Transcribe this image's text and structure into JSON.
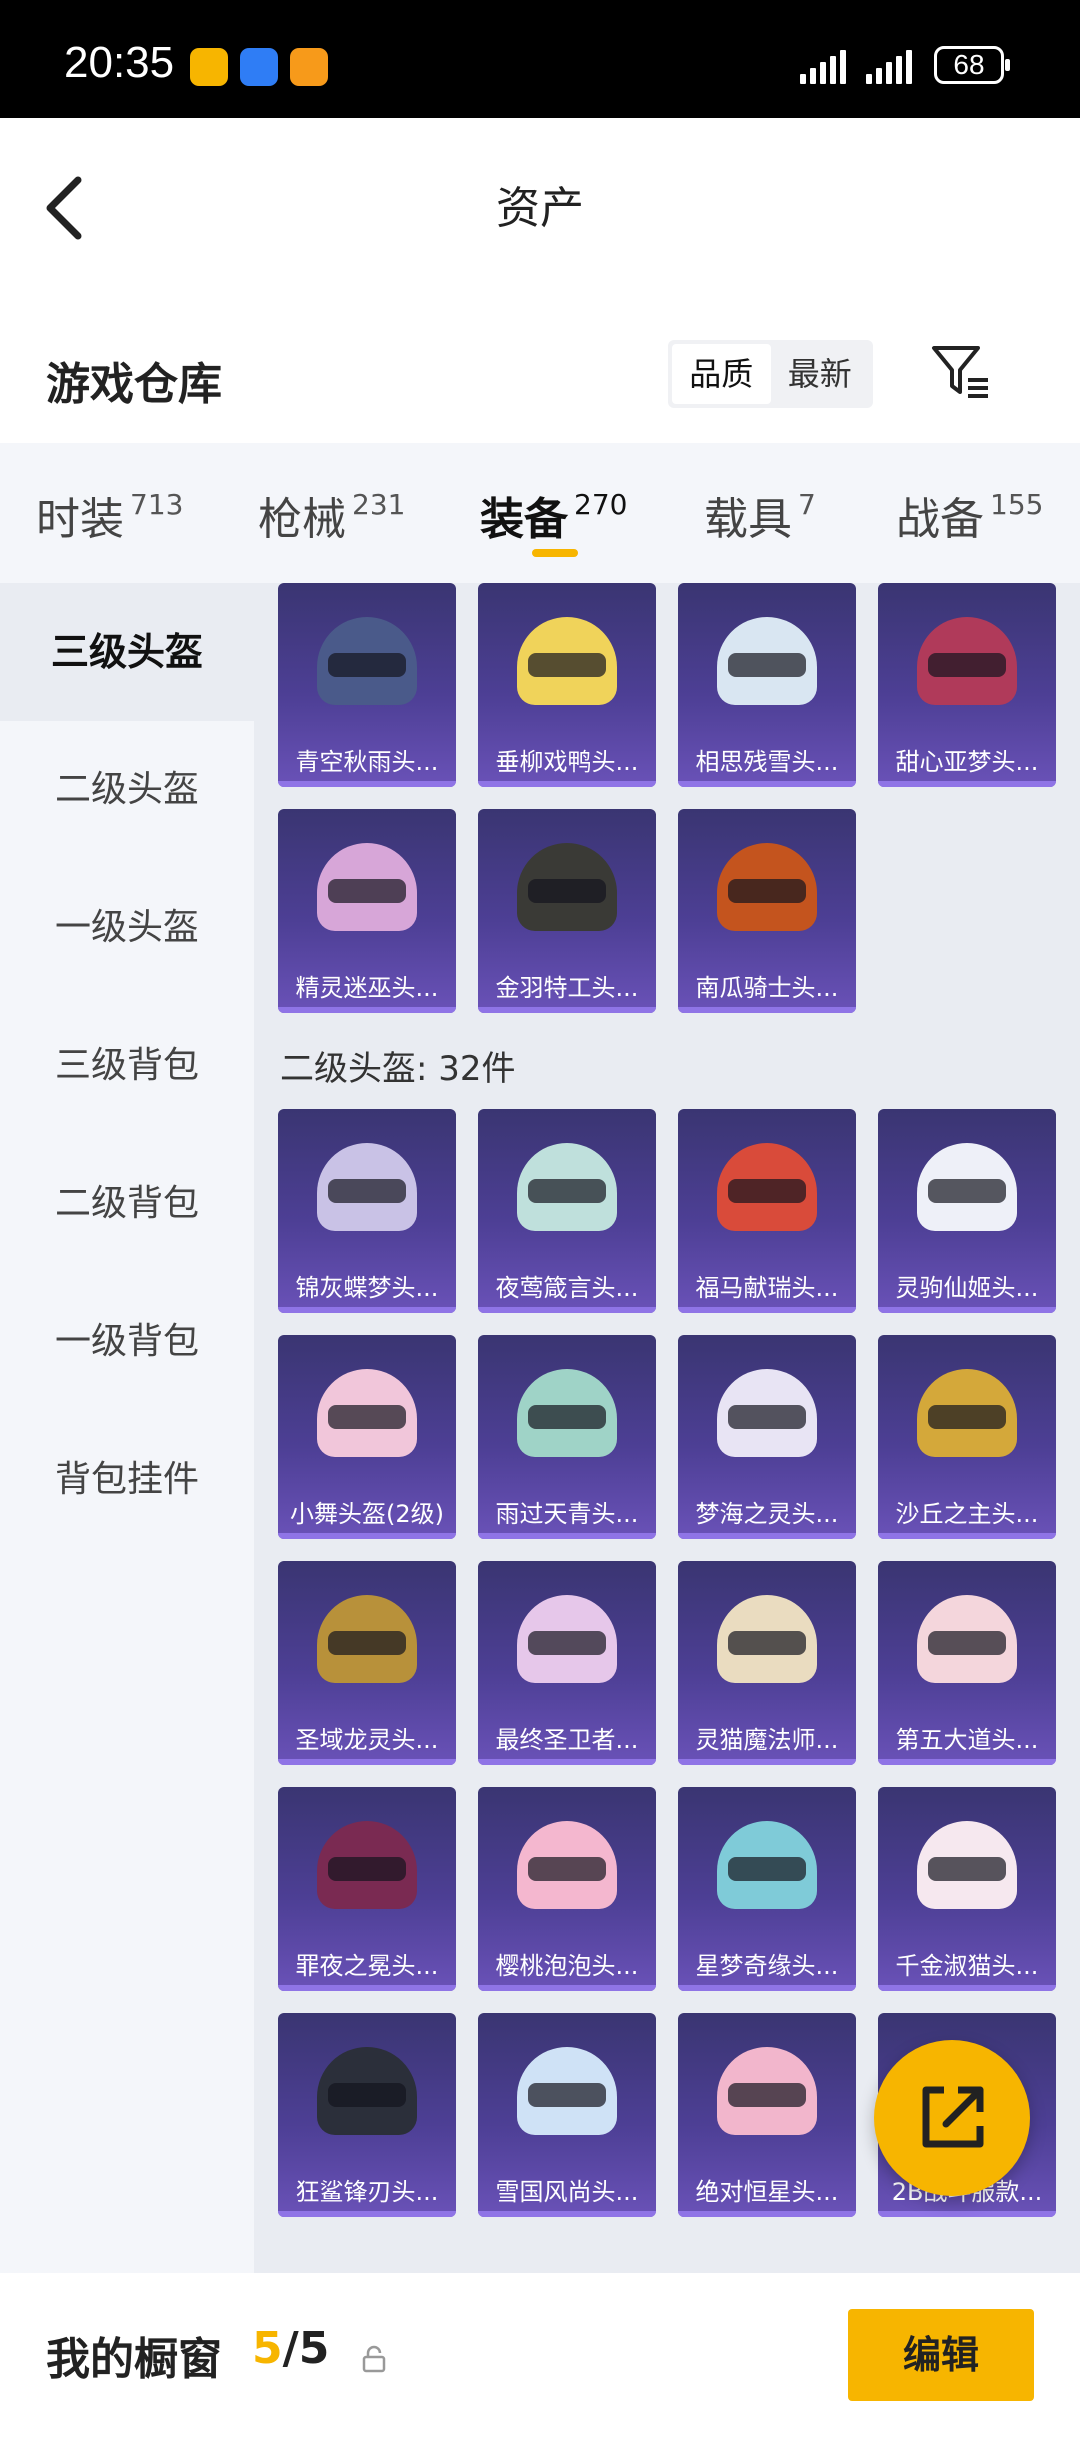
{
  "status": {
    "time": "20:35",
    "battery": "68"
  },
  "header": {
    "title": "资产"
  },
  "warehouse": {
    "title": "游戏仓库",
    "sort_quality": "品质",
    "sort_latest": "最新"
  },
  "categories": [
    {
      "label": "时装",
      "count": "713"
    },
    {
      "label": "枪械",
      "count": "231"
    },
    {
      "label": "装备",
      "count": "270"
    },
    {
      "label": "载具",
      "count": "7"
    },
    {
      "label": "战备",
      "count": "155"
    }
  ],
  "sidebar": [
    {
      "label": "三级头盔"
    },
    {
      "label": "二级头盔"
    },
    {
      "label": "一级头盔"
    },
    {
      "label": "三级背包"
    },
    {
      "label": "二级背包"
    },
    {
      "label": "一级背包"
    },
    {
      "label": "背包挂件"
    }
  ],
  "section_level2": {
    "title": "二级头盔: 32件"
  },
  "items_level3": [
    {
      "name": "青空秋雨头...",
      "color": "#4a5a8a"
    },
    {
      "name": "垂柳戏鸭头...",
      "color": "#f0d35a"
    },
    {
      "name": "相思残雪头...",
      "color": "#d9e6f2"
    },
    {
      "name": "甜心亚梦头...",
      "color": "#b03a5a"
    },
    {
      "name": "精灵迷巫头...",
      "color": "#d7a6d8"
    },
    {
      "name": "金羽特工头...",
      "color": "#3a3a36"
    },
    {
      "name": "南瓜骑士头...",
      "color": "#c4541e"
    }
  ],
  "items_level2": [
    {
      "name": "锦灰蝶梦头...",
      "color": "#c9c2e6"
    },
    {
      "name": "夜莺箴言头...",
      "color": "#bfe0dc"
    },
    {
      "name": "福马献瑞头...",
      "color": "#d94b3a"
    },
    {
      "name": "灵驹仙姬头...",
      "color": "#eef0f8"
    },
    {
      "name": "小舞头盔(2级)",
      "color": "#f1c6da"
    },
    {
      "name": "雨过天青头...",
      "color": "#9fd3c7"
    },
    {
      "name": "梦海之灵头...",
      "color": "#e8e4f4"
    },
    {
      "name": "沙丘之主头...",
      "color": "#d4a83a"
    },
    {
      "name": "圣域龙灵头...",
      "color": "#b8913a"
    },
    {
      "name": "最终圣卫者...",
      "color": "#e6c7ea"
    },
    {
      "name": "灵猫魔法师...",
      "color": "#eadcc0"
    },
    {
      "name": "第五大道头...",
      "color": "#f4d6dc"
    },
    {
      "name": "罪夜之冕头...",
      "color": "#7a2a52"
    },
    {
      "name": "樱桃泡泡头...",
      "color": "#f4b7cf"
    },
    {
      "name": "星梦奇缘头...",
      "color": "#7fcbd8"
    },
    {
      "name": "千金淑猫头...",
      "color": "#f6e8ef"
    },
    {
      "name": "狂鲨锋刃头...",
      "color": "#2b2f3a"
    },
    {
      "name": "雪国风尚头...",
      "color": "#cfe2f6"
    },
    {
      "name": "绝对恒星头...",
      "color": "#f2b6cc"
    },
    {
      "name": "2B战斗服款...",
      "color": "#d8d8de"
    }
  ],
  "bottom": {
    "label": "我的橱窗",
    "count_current": "5",
    "count_sep": "/",
    "count_total": "5",
    "edit": "编辑"
  }
}
